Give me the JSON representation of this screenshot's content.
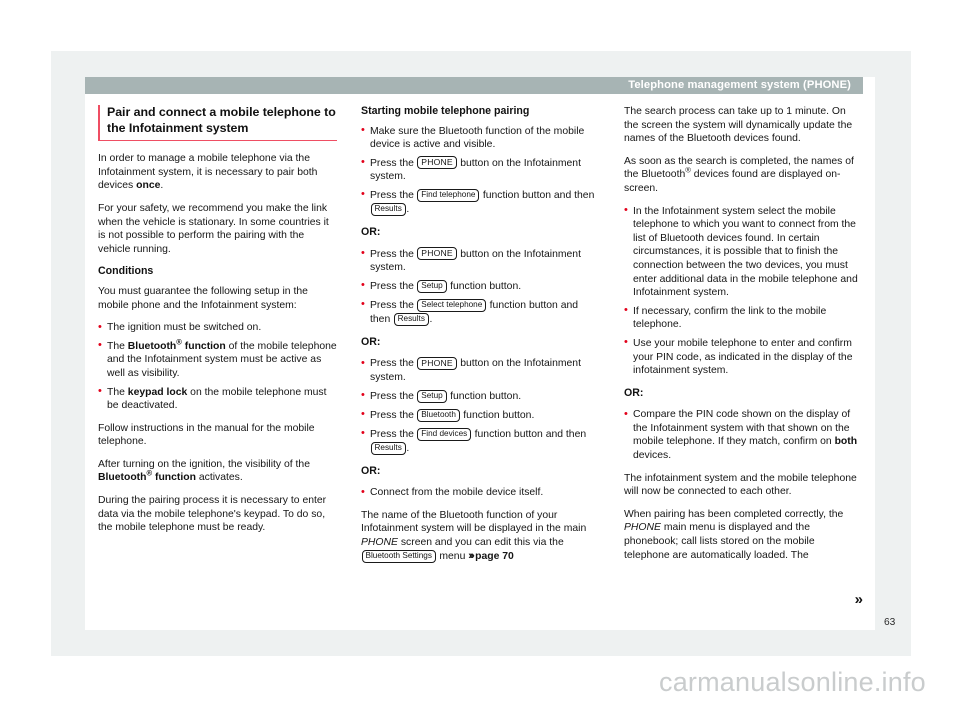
{
  "header": {
    "running_title": "Telephone management system (PHONE)"
  },
  "folio": {
    "page_number": "63"
  },
  "watermark": {
    "text": "carmanualsonline.info"
  },
  "continuation": {
    "marker": "»"
  },
  "colors": {
    "header_bar": "#a7b4b4",
    "accent_rule": "#ef4e63",
    "bullet_red": "#e2001a",
    "page_bg": "#ffffff",
    "shadow_bg": "#eef1f1",
    "text": "#161616"
  },
  "column1": {
    "heading": "Pair and connect a mobile telephone to the Infotainment system",
    "p1_a": "In order to manage a mobile telephone via the Infotainment system, it is necessary to pair both devices ",
    "p1_b": "once",
    "p1_c": ".",
    "p2": "For your safety, we recommend you make the link when the vehicle is stationary. In some countries it is not possible to perform the pairing with the vehicle running.",
    "conditions_heading": "Conditions",
    "p3": "You must guarantee the following setup in the mobile phone and the Infotainment system:",
    "bullet1": "The ignition must be switched on.",
    "bullet2_a": "The ",
    "bullet2_b": "Bluetooth",
    "bullet2_reg": "®",
    "bullet2_c": " function",
    "bullet2_d": " of the mobile telephone and the Infotainment system must be active as well as visibility.",
    "bullet3_a": "The ",
    "bullet3_b": "keypad lock",
    "bullet3_c": " on the mobile telephone must be deactivated.",
    "p4": "Follow instructions in the manual for the mobile telephone.",
    "p5_a": "After turning on the ignition, the visibility of the ",
    "p5_b": "Bluetooth",
    "p5_reg": "®",
    "p5_c": " function",
    "p5_d": " activates.",
    "p6": "During the pairing process it is necessary to enter data via the mobile telephone's keypad. To do so, the mobile telephone must be ready."
  },
  "column2": {
    "heading": "Starting mobile telephone pairing",
    "b1": "Make sure the Bluetooth function of the mobile device is active and visible.",
    "b2_a": "Press the ",
    "b2_key": "PHONE",
    "b2_b": " button on the Infotainment system.",
    "b3_a": "Press the ",
    "b3_key": "Find telephone",
    "b3_b": " function button and then ",
    "b3_key2": "Results",
    "b3_c": ".",
    "or1": "OR:",
    "b4_a": "Press the ",
    "b4_key": "PHONE",
    "b4_b": " button on the Infotainment system.",
    "b5_a": "Press the ",
    "b5_key": "Setup",
    "b5_b": " function button.",
    "b6_a": "Press the ",
    "b6_key": "Select telephone",
    "b6_b": " function button and then ",
    "b6_key2": "Results",
    "b6_c": ".",
    "or2": "OR:",
    "b7_a": "Press the ",
    "b7_key": "PHONE",
    "b7_b": " button on the Infotainment system.",
    "b8_a": "Press the ",
    "b8_key": "Setup",
    "b8_b": " function button.",
    "b9_a": "Press the ",
    "b9_key": "Bluetooth",
    "b9_b": " function button.",
    "b10_a": "Press the ",
    "b10_key": "Find devices",
    "b10_b": " function button and then ",
    "b10_key2": "Results",
    "b10_c": ".",
    "or3": "OR:",
    "b11": "Connect from the mobile device itself.",
    "p_end_a": "The name of the Bluetooth function of your Infotainment system will be displayed in the main ",
    "p_end_italic": "PHONE",
    "p_end_b": " screen and you can edit this via the ",
    "p_end_key": "Bluetooth Settings",
    "p_end_c": " menu ",
    "p_end_xref_chev": "›››",
    "p_end_xref": "page 70"
  },
  "column3": {
    "p1": "The search process can take up to 1 minute. On the screen the system will dynamically update the names of the Bluetooth devices found.",
    "p2_a": "As soon as the search is completed, the names of the Bluetooth",
    "p2_reg": "®",
    "p2_b": " devices found are displayed on-screen.",
    "b1": "In the Infotainment system select the mobile telephone to which you want to connect from the list of Bluetooth devices found. In certain circumstances, it is possible that to finish the connection between the two devices, you must enter additional data in the mobile telephone and Infotainment system.",
    "b2": "If necessary, confirm the link to the mobile telephone.",
    "b3": "Use your mobile telephone to enter and confirm your PIN code, as indicated in the display of the infotainment system.",
    "or1": "OR:",
    "b4_a": "Compare the PIN code shown on the display of the Infotainment system with that shown on the mobile telephone. If they match, confirm on ",
    "b4_b": "both",
    "b4_c": " devices.",
    "p3": "The infotainment system and the mobile telephone will now be connected to each other.",
    "p4_a": "When pairing has been completed correctly, the ",
    "p4_italic": "PHONE",
    "p4_b": " main menu is displayed and the phonebook; call lists stored on the mobile telephone are automatically loaded. The"
  }
}
